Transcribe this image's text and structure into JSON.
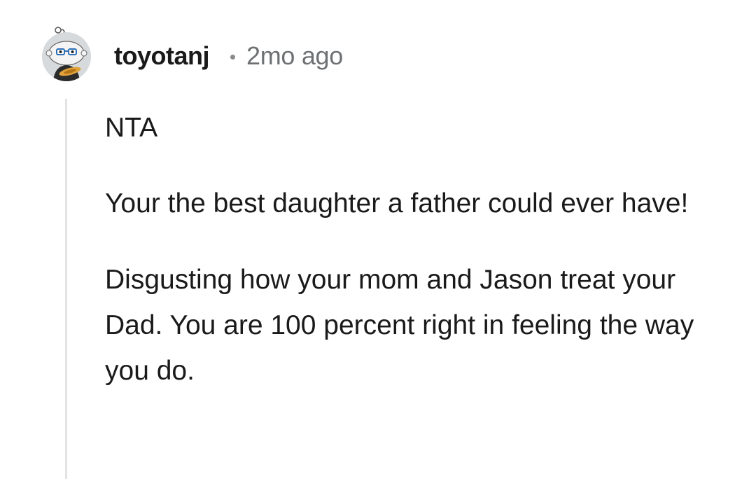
{
  "comment": {
    "username": "toyotanj",
    "timestamp": "2mo ago",
    "paragraphs": [
      "NTA",
      "Your the best daughter a father could ever have!",
      "Disgusting how your mom and Jason treat your Dad. You are 100 percent right in feeling the way you do."
    ]
  },
  "icons": {
    "avatar": "user-avatar-icon"
  },
  "colors": {
    "text": "#1a1a1b",
    "meta": "#6e7173",
    "thread_line": "#e2e3e4"
  }
}
